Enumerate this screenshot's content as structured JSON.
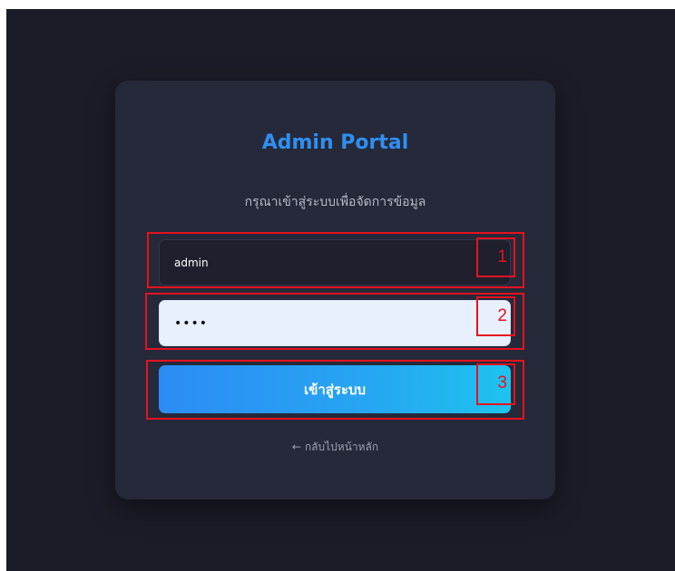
{
  "login": {
    "title": "Admin Portal",
    "subtitle": "กรุณาเข้าสู่ระบบเพื่อจัดการข้อมูล",
    "username_value": "admin",
    "password_value": "••••",
    "submit_label": "เข้าสู่ระบบ",
    "back_arrow": "←",
    "back_label": "กลับไปหน้าหลัก"
  },
  "annotations": [
    {
      "number": "1"
    },
    {
      "number": "2"
    },
    {
      "number": "3"
    }
  ],
  "colors": {
    "background": "#1c1c28",
    "card": "#262939",
    "accent": "#2f8ff0",
    "annotation": "#e5121f"
  }
}
